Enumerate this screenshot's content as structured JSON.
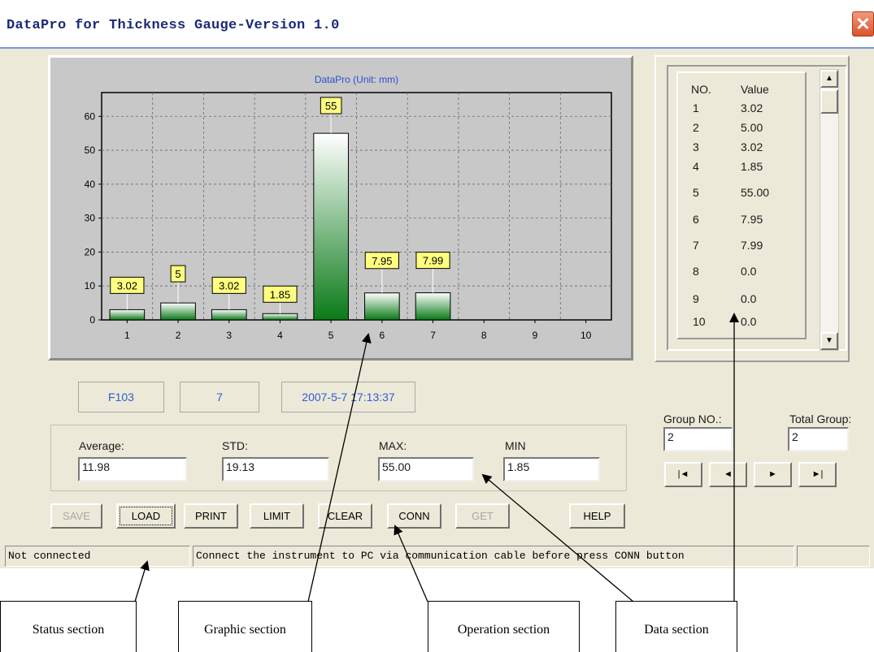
{
  "window": {
    "title": "DataPro for Thickness Gauge-Version 1.0",
    "close_glyph": "✕"
  },
  "chart_data": {
    "type": "bar",
    "title": "DataPro (Unit: mm)",
    "categories": [
      "1",
      "2",
      "3",
      "4",
      "5",
      "6",
      "7",
      "8",
      "9",
      "10"
    ],
    "values": [
      3.02,
      5,
      3.02,
      1.85,
      55,
      7.95,
      7.99,
      0,
      0,
      0
    ],
    "data_labels": [
      "3.02",
      "5",
      "3.02",
      "1.85",
      "55",
      "7.95",
      "7.99"
    ],
    "y_ticks": [
      "0",
      "10",
      "20",
      "30",
      "40",
      "50",
      "60"
    ],
    "ylim": [
      0,
      67
    ],
    "grid": true,
    "colors": {
      "bar_highlight": "#0a7a18",
      "label_bg": "#ffff80",
      "plot_bg": "#c8c8c8"
    }
  },
  "data_section": {
    "header": {
      "no": "NO.",
      "value": "Value"
    },
    "rows": [
      {
        "no": "1",
        "value": "3.02"
      },
      {
        "no": "2",
        "value": "5.00"
      },
      {
        "no": "3",
        "value": "3.02"
      },
      {
        "no": "4",
        "value": "1.85"
      },
      {
        "no": "5",
        "value": "55.00"
      },
      {
        "no": "6",
        "value": "7.95"
      },
      {
        "no": "7",
        "value": "7.99"
      },
      {
        "no": "8",
        "value": "0.0"
      },
      {
        "no": "9",
        "value": "0.0"
      },
      {
        "no": "10",
        "value": "0.0"
      }
    ],
    "scroll_up_glyph": "▲",
    "scroll_down_glyph": "▼"
  },
  "info": {
    "probe": "F103",
    "count": "7",
    "datetime": "2007-5-7 17:13:37"
  },
  "stats": {
    "average_label": "Average:",
    "average": "11.98",
    "std_label": "STD:",
    "std": "19.13",
    "max_label": "MAX:",
    "max": "55.00",
    "min_label": "MIN",
    "min": "1.85"
  },
  "group": {
    "group_no_label": "Group NO.:",
    "group_no": "2",
    "total_label": "Total Group:",
    "total": "2",
    "nav": {
      "first": "|◄",
      "prev": "◄",
      "next": "►",
      "last": "►|"
    }
  },
  "buttons": {
    "save": "SAVE",
    "load": "LOAD",
    "print": "PRINT",
    "limit": "LIMIT",
    "clear": "CLEAR",
    "conn": "CONN",
    "get": "GET",
    "help": "HELP"
  },
  "status": {
    "connection": "Not connected",
    "message": "Connect the instrument to PC via communication cable before press CONN button"
  },
  "callouts": {
    "status": "Status section",
    "graphic": "Graphic section",
    "operation": "Operation section",
    "data": "Data section"
  }
}
